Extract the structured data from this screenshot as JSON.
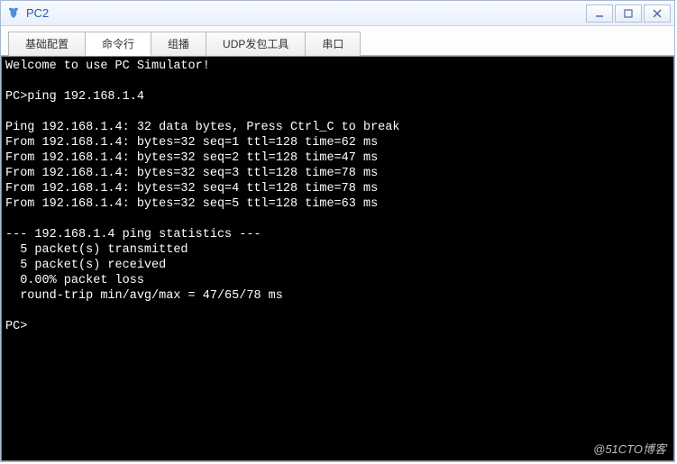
{
  "window": {
    "title": "PC2"
  },
  "tabs": [
    {
      "label": "基础配置",
      "active": false
    },
    {
      "label": "命令行",
      "active": true
    },
    {
      "label": "组播",
      "active": false
    },
    {
      "label": "UDP发包工具",
      "active": false
    },
    {
      "label": "串口",
      "active": false
    }
  ],
  "terminal": {
    "lines": [
      "Welcome to use PC Simulator!",
      "",
      "PC>ping 192.168.1.4",
      "",
      "Ping 192.168.1.4: 32 data bytes, Press Ctrl_C to break",
      "From 192.168.1.4: bytes=32 seq=1 ttl=128 time=62 ms",
      "From 192.168.1.4: bytes=32 seq=2 ttl=128 time=47 ms",
      "From 192.168.1.4: bytes=32 seq=3 ttl=128 time=78 ms",
      "From 192.168.1.4: bytes=32 seq=4 ttl=128 time=78 ms",
      "From 192.168.1.4: bytes=32 seq=5 ttl=128 time=63 ms",
      "",
      "--- 192.168.1.4 ping statistics ---",
      "  5 packet(s) transmitted",
      "  5 packet(s) received",
      "  0.00% packet loss",
      "  round-trip min/avg/max = 47/65/78 ms",
      "",
      "PC>"
    ]
  },
  "watermark": "@51CTO博客"
}
